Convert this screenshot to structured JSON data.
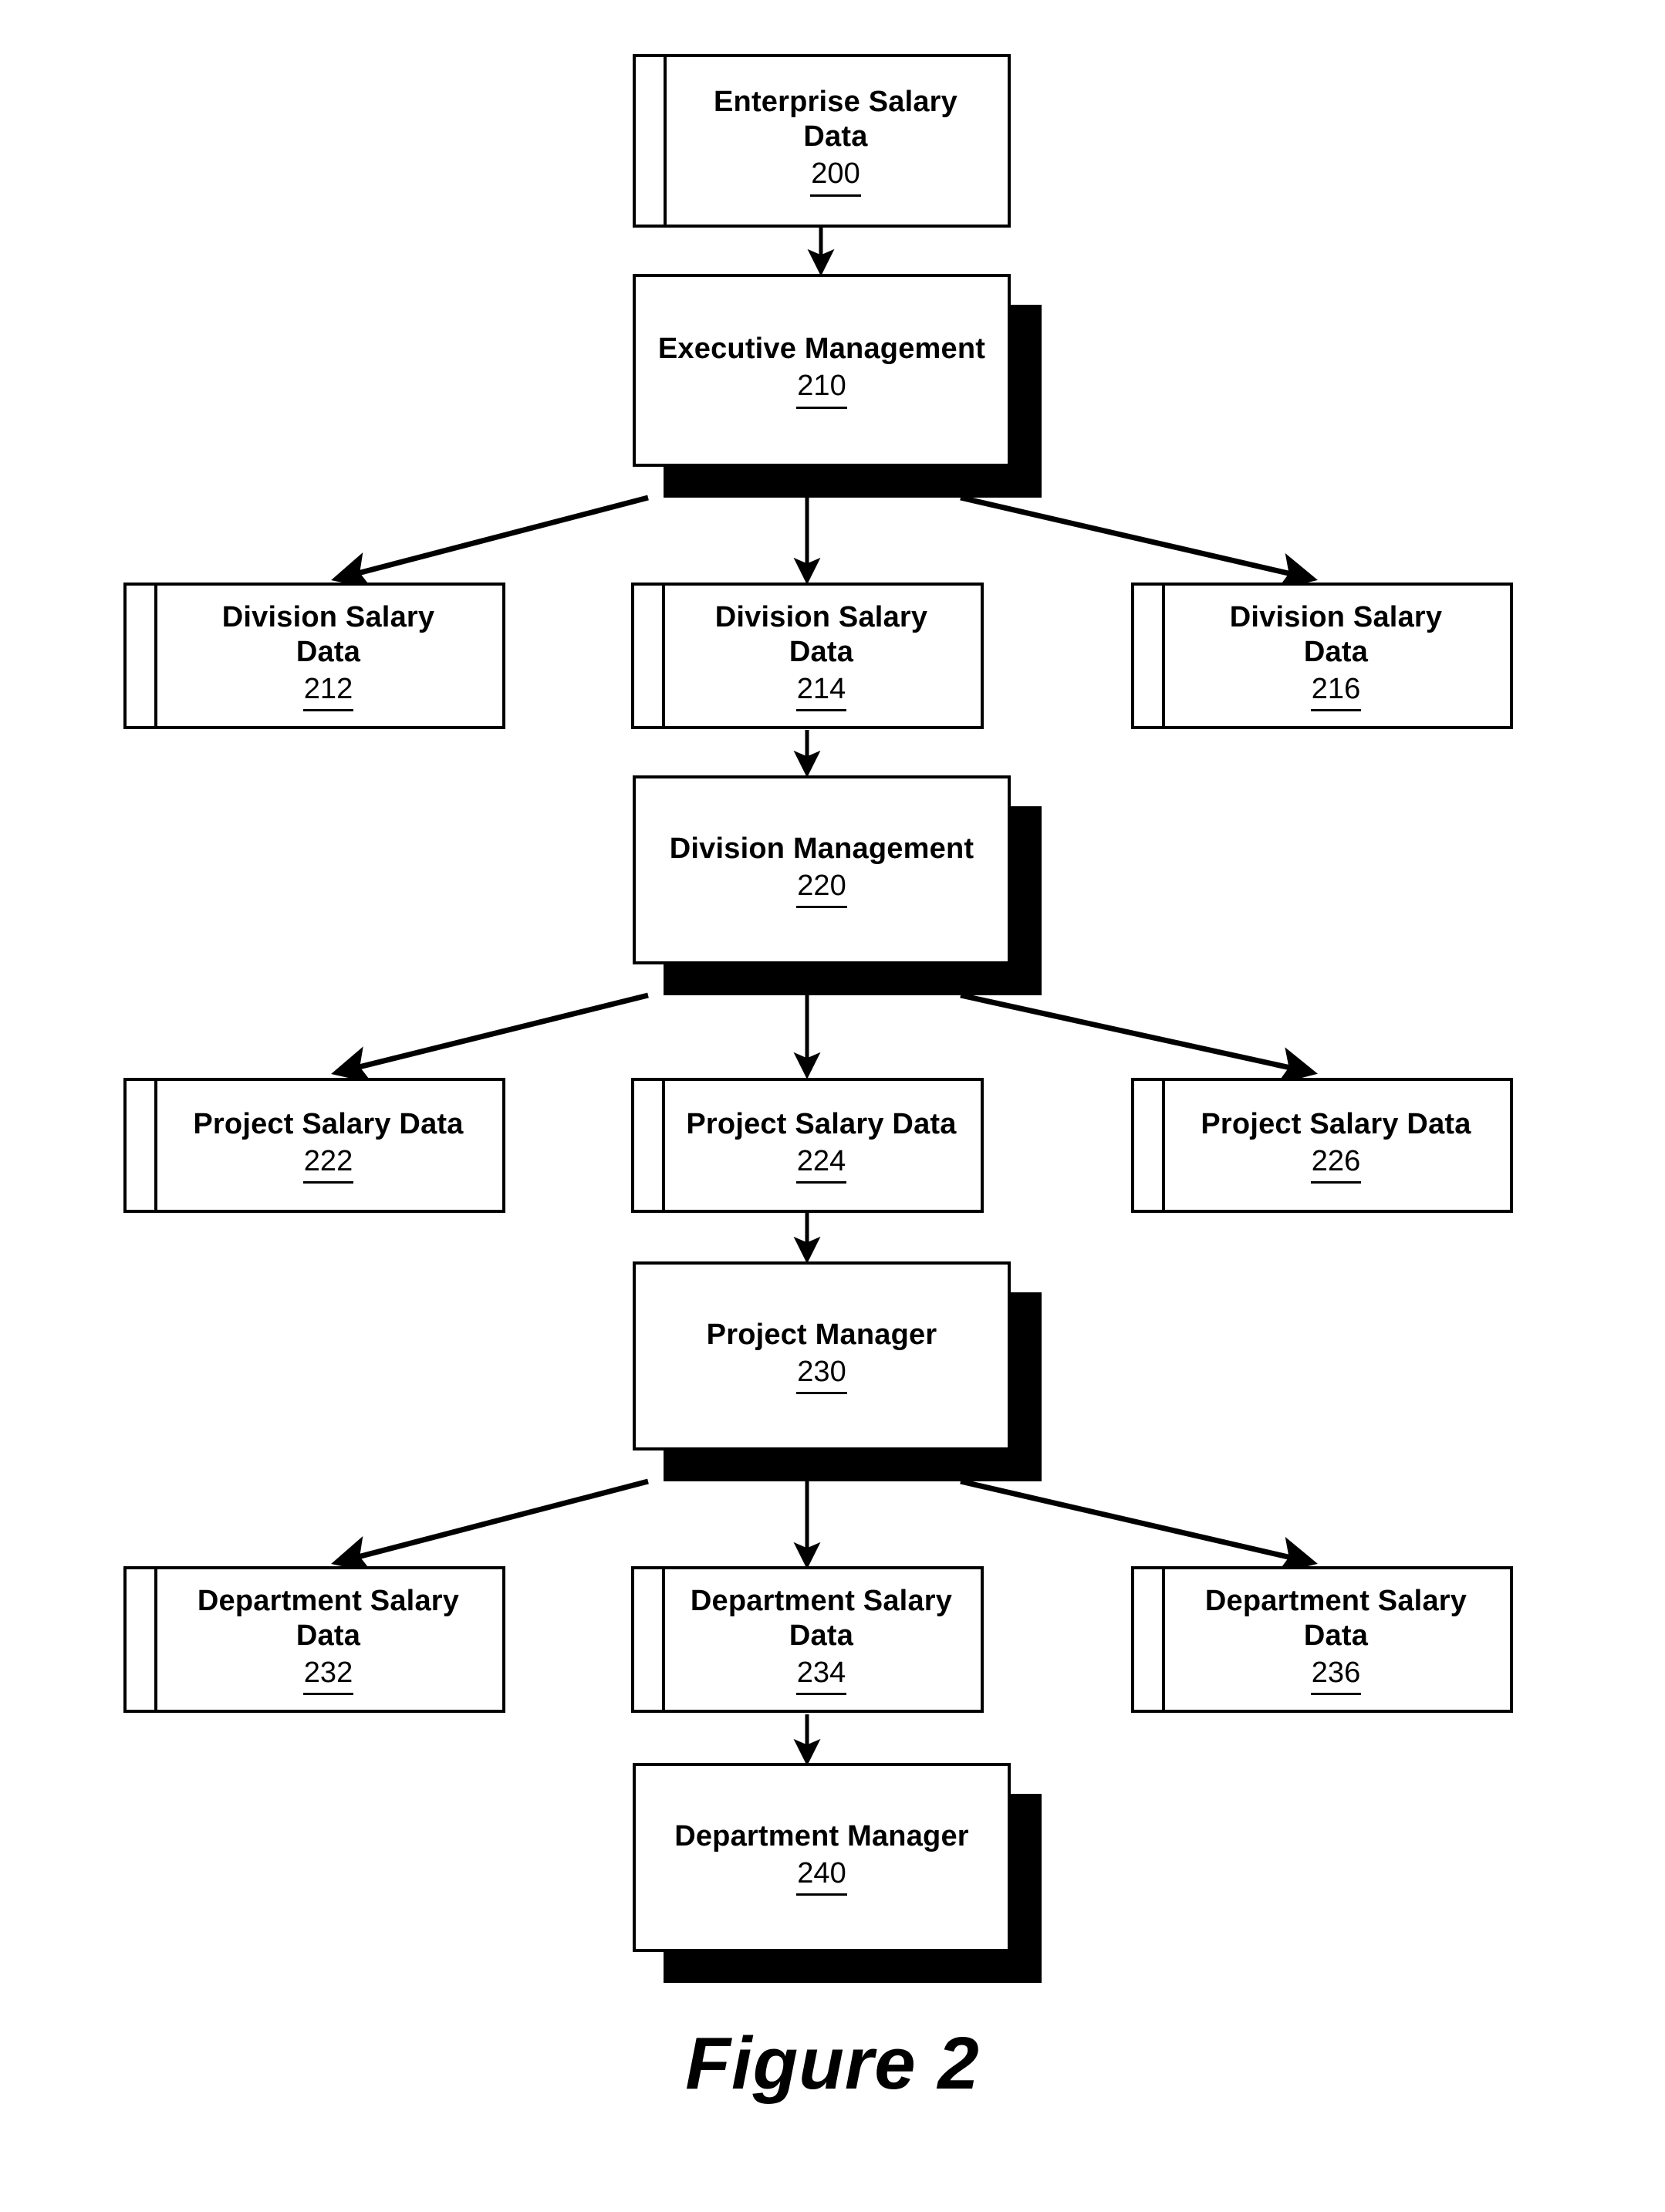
{
  "figure": {
    "caption": "Figure 2"
  },
  "diagram": {
    "type": "hierarchy-flowchart",
    "nodes": [
      {
        "id": "enterprise-salary-data",
        "label": "Enterprise  Salary\nData",
        "ref": "200",
        "shape": "data-store",
        "level": 0,
        "column": "center"
      },
      {
        "id": "executive-management",
        "label": "Executive Management",
        "ref": "210",
        "shape": "process",
        "level": 1,
        "column": "center"
      },
      {
        "id": "division-salary-data-212",
        "label": "Division Salary\nData",
        "ref": "212",
        "shape": "data-store",
        "level": 2,
        "column": "left"
      },
      {
        "id": "division-salary-data-214",
        "label": "Division Salary\nData",
        "ref": "214",
        "shape": "data-store",
        "level": 2,
        "column": "center"
      },
      {
        "id": "division-salary-data-216",
        "label": "Division Salary\nData",
        "ref": "216",
        "shape": "data-store",
        "level": 2,
        "column": "right"
      },
      {
        "id": "division-management",
        "label": "Division Management",
        "ref": "220",
        "shape": "process",
        "level": 3,
        "column": "center"
      },
      {
        "id": "project-salary-data-222",
        "label": "Project Salary Data",
        "ref": "222",
        "shape": "data-store",
        "level": 4,
        "column": "left"
      },
      {
        "id": "project-salary-data-224",
        "label": "Project Salary Data",
        "ref": "224",
        "shape": "data-store",
        "level": 4,
        "column": "center"
      },
      {
        "id": "project-salary-data-226",
        "label": "Project Salary Data",
        "ref": "226",
        "shape": "data-store",
        "level": 4,
        "column": "right"
      },
      {
        "id": "project-manager",
        "label": "Project Manager",
        "ref": "230",
        "shape": "process",
        "level": 5,
        "column": "center"
      },
      {
        "id": "department-salary-data-232",
        "label": "Department Salary\nData",
        "ref": "232",
        "shape": "data-store",
        "level": 6,
        "column": "left"
      },
      {
        "id": "department-salary-data-234",
        "label": "Department Salary\nData",
        "ref": "234",
        "shape": "data-store",
        "level": 6,
        "column": "center"
      },
      {
        "id": "department-salary-data-236",
        "label": "Department Salary\nData",
        "ref": "236",
        "shape": "data-store",
        "level": 6,
        "column": "right"
      },
      {
        "id": "department-manager",
        "label": "Department Manager",
        "ref": "240",
        "shape": "process",
        "level": 7,
        "column": "center"
      }
    ],
    "edges": [
      {
        "from": "enterprise-salary-data",
        "to": "executive-management",
        "style": "straight-down"
      },
      {
        "from": "executive-management",
        "to": "division-salary-data-212",
        "style": "diagonal-left"
      },
      {
        "from": "executive-management",
        "to": "division-salary-data-214",
        "style": "straight-down"
      },
      {
        "from": "executive-management",
        "to": "division-salary-data-216",
        "style": "diagonal-right"
      },
      {
        "from": "division-salary-data-214",
        "to": "division-management",
        "style": "straight-down"
      },
      {
        "from": "division-management",
        "to": "project-salary-data-222",
        "style": "diagonal-left"
      },
      {
        "from": "division-management",
        "to": "project-salary-data-224",
        "style": "straight-down"
      },
      {
        "from": "division-management",
        "to": "project-salary-data-226",
        "style": "diagonal-right"
      },
      {
        "from": "project-salary-data-224",
        "to": "project-manager",
        "style": "straight-down"
      },
      {
        "from": "project-manager",
        "to": "department-salary-data-232",
        "style": "diagonal-left"
      },
      {
        "from": "project-manager",
        "to": "department-salary-data-234",
        "style": "straight-down"
      },
      {
        "from": "project-manager",
        "to": "department-salary-data-236",
        "style": "diagonal-right"
      },
      {
        "from": "department-salary-data-234",
        "to": "department-manager",
        "style": "straight-down"
      }
    ],
    "colors": {
      "stroke": "#000000",
      "fill": "#ffffff",
      "shadow": "#000000"
    }
  }
}
